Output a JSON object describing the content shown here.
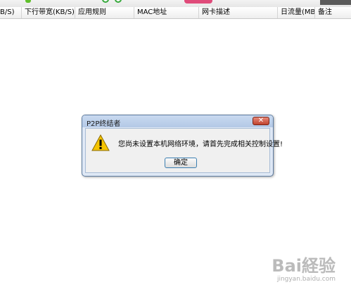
{
  "table_header": {
    "columns": [
      "B/S)",
      "下行带宽(KB/S)",
      "应用规则",
      "MAC地址",
      "网卡描述",
      "日流量(MB)",
      "备注"
    ]
  },
  "dialog": {
    "title": "P2P终结者",
    "close_label": "✕",
    "message": "您尚未设置本机网络环境，请首先完成相关控制设置!",
    "ok_label": "确定",
    "icon": "warning-icon"
  },
  "watermark": {
    "logo": "Bai経验",
    "url": "jingyan.baidu.com"
  },
  "colors": {
    "dialog_frame": "#dfe8f5",
    "close_button": "#c0432e",
    "warning_yellow": "#f5c400",
    "ok_border": "#3c7fb1"
  }
}
